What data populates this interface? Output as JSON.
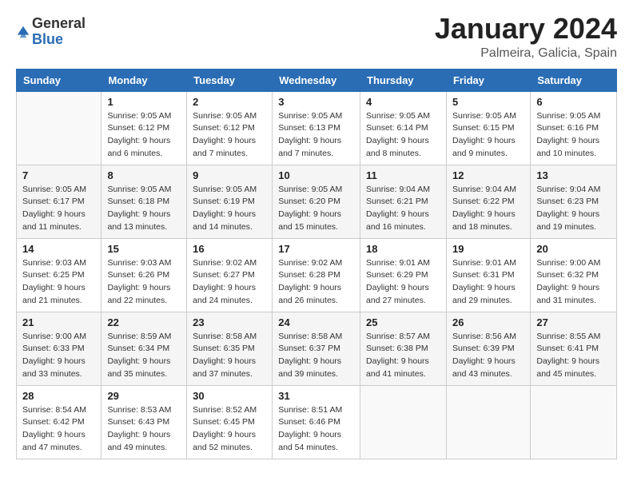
{
  "header": {
    "logo_general": "General",
    "logo_blue": "Blue",
    "title": "January 2024",
    "location": "Palmeira, Galicia, Spain"
  },
  "days_of_week": [
    "Sunday",
    "Monday",
    "Tuesday",
    "Wednesday",
    "Thursday",
    "Friday",
    "Saturday"
  ],
  "weeks": [
    [
      {
        "day": "",
        "sunrise": "",
        "sunset": "",
        "daylight": ""
      },
      {
        "day": "1",
        "sunrise": "Sunrise: 9:05 AM",
        "sunset": "Sunset: 6:12 PM",
        "daylight": "Daylight: 9 hours and 6 minutes."
      },
      {
        "day": "2",
        "sunrise": "Sunrise: 9:05 AM",
        "sunset": "Sunset: 6:12 PM",
        "daylight": "Daylight: 9 hours and 7 minutes."
      },
      {
        "day": "3",
        "sunrise": "Sunrise: 9:05 AM",
        "sunset": "Sunset: 6:13 PM",
        "daylight": "Daylight: 9 hours and 7 minutes."
      },
      {
        "day": "4",
        "sunrise": "Sunrise: 9:05 AM",
        "sunset": "Sunset: 6:14 PM",
        "daylight": "Daylight: 9 hours and 8 minutes."
      },
      {
        "day": "5",
        "sunrise": "Sunrise: 9:05 AM",
        "sunset": "Sunset: 6:15 PM",
        "daylight": "Daylight: 9 hours and 9 minutes."
      },
      {
        "day": "6",
        "sunrise": "Sunrise: 9:05 AM",
        "sunset": "Sunset: 6:16 PM",
        "daylight": "Daylight: 9 hours and 10 minutes."
      }
    ],
    [
      {
        "day": "7",
        "sunrise": "Sunrise: 9:05 AM",
        "sunset": "Sunset: 6:17 PM",
        "daylight": "Daylight: 9 hours and 11 minutes."
      },
      {
        "day": "8",
        "sunrise": "Sunrise: 9:05 AM",
        "sunset": "Sunset: 6:18 PM",
        "daylight": "Daylight: 9 hours and 13 minutes."
      },
      {
        "day": "9",
        "sunrise": "Sunrise: 9:05 AM",
        "sunset": "Sunset: 6:19 PM",
        "daylight": "Daylight: 9 hours and 14 minutes."
      },
      {
        "day": "10",
        "sunrise": "Sunrise: 9:05 AM",
        "sunset": "Sunset: 6:20 PM",
        "daylight": "Daylight: 9 hours and 15 minutes."
      },
      {
        "day": "11",
        "sunrise": "Sunrise: 9:04 AM",
        "sunset": "Sunset: 6:21 PM",
        "daylight": "Daylight: 9 hours and 16 minutes."
      },
      {
        "day": "12",
        "sunrise": "Sunrise: 9:04 AM",
        "sunset": "Sunset: 6:22 PM",
        "daylight": "Daylight: 9 hours and 18 minutes."
      },
      {
        "day": "13",
        "sunrise": "Sunrise: 9:04 AM",
        "sunset": "Sunset: 6:23 PM",
        "daylight": "Daylight: 9 hours and 19 minutes."
      }
    ],
    [
      {
        "day": "14",
        "sunrise": "Sunrise: 9:03 AM",
        "sunset": "Sunset: 6:25 PM",
        "daylight": "Daylight: 9 hours and 21 minutes."
      },
      {
        "day": "15",
        "sunrise": "Sunrise: 9:03 AM",
        "sunset": "Sunset: 6:26 PM",
        "daylight": "Daylight: 9 hours and 22 minutes."
      },
      {
        "day": "16",
        "sunrise": "Sunrise: 9:02 AM",
        "sunset": "Sunset: 6:27 PM",
        "daylight": "Daylight: 9 hours and 24 minutes."
      },
      {
        "day": "17",
        "sunrise": "Sunrise: 9:02 AM",
        "sunset": "Sunset: 6:28 PM",
        "daylight": "Daylight: 9 hours and 26 minutes."
      },
      {
        "day": "18",
        "sunrise": "Sunrise: 9:01 AM",
        "sunset": "Sunset: 6:29 PM",
        "daylight": "Daylight: 9 hours and 27 minutes."
      },
      {
        "day": "19",
        "sunrise": "Sunrise: 9:01 AM",
        "sunset": "Sunset: 6:31 PM",
        "daylight": "Daylight: 9 hours and 29 minutes."
      },
      {
        "day": "20",
        "sunrise": "Sunrise: 9:00 AM",
        "sunset": "Sunset: 6:32 PM",
        "daylight": "Daylight: 9 hours and 31 minutes."
      }
    ],
    [
      {
        "day": "21",
        "sunrise": "Sunrise: 9:00 AM",
        "sunset": "Sunset: 6:33 PM",
        "daylight": "Daylight: 9 hours and 33 minutes."
      },
      {
        "day": "22",
        "sunrise": "Sunrise: 8:59 AM",
        "sunset": "Sunset: 6:34 PM",
        "daylight": "Daylight: 9 hours and 35 minutes."
      },
      {
        "day": "23",
        "sunrise": "Sunrise: 8:58 AM",
        "sunset": "Sunset: 6:35 PM",
        "daylight": "Daylight: 9 hours and 37 minutes."
      },
      {
        "day": "24",
        "sunrise": "Sunrise: 8:58 AM",
        "sunset": "Sunset: 6:37 PM",
        "daylight": "Daylight: 9 hours and 39 minutes."
      },
      {
        "day": "25",
        "sunrise": "Sunrise: 8:57 AM",
        "sunset": "Sunset: 6:38 PM",
        "daylight": "Daylight: 9 hours and 41 minutes."
      },
      {
        "day": "26",
        "sunrise": "Sunrise: 8:56 AM",
        "sunset": "Sunset: 6:39 PM",
        "daylight": "Daylight: 9 hours and 43 minutes."
      },
      {
        "day": "27",
        "sunrise": "Sunrise: 8:55 AM",
        "sunset": "Sunset: 6:41 PM",
        "daylight": "Daylight: 9 hours and 45 minutes."
      }
    ],
    [
      {
        "day": "28",
        "sunrise": "Sunrise: 8:54 AM",
        "sunset": "Sunset: 6:42 PM",
        "daylight": "Daylight: 9 hours and 47 minutes."
      },
      {
        "day": "29",
        "sunrise": "Sunrise: 8:53 AM",
        "sunset": "Sunset: 6:43 PM",
        "daylight": "Daylight: 9 hours and 49 minutes."
      },
      {
        "day": "30",
        "sunrise": "Sunrise: 8:52 AM",
        "sunset": "Sunset: 6:45 PM",
        "daylight": "Daylight: 9 hours and 52 minutes."
      },
      {
        "day": "31",
        "sunrise": "Sunrise: 8:51 AM",
        "sunset": "Sunset: 6:46 PM",
        "daylight": "Daylight: 9 hours and 54 minutes."
      },
      {
        "day": "",
        "sunrise": "",
        "sunset": "",
        "daylight": ""
      },
      {
        "day": "",
        "sunrise": "",
        "sunset": "",
        "daylight": ""
      },
      {
        "day": "",
        "sunrise": "",
        "sunset": "",
        "daylight": ""
      }
    ]
  ]
}
